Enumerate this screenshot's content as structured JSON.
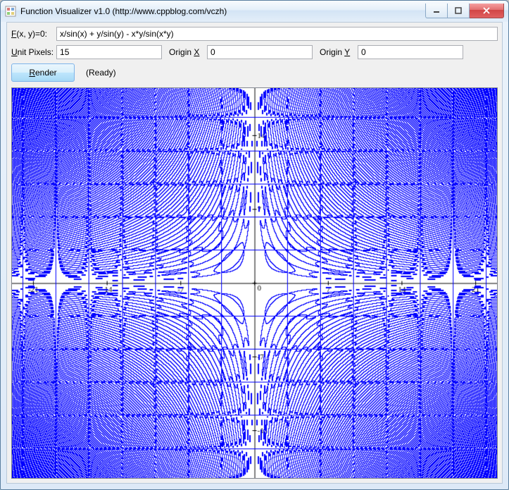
{
  "window": {
    "title": "Function Visualizer v1.0 (http://www.cppblog.com/vczh)"
  },
  "form": {
    "formula_label_prefix": "F",
    "formula_label_rest": "(x, y)=0:",
    "formula_value": "x/sin(x) + y/sin(y) - x*y/sin(x*y)",
    "unit_label_prefix": "U",
    "unit_label_rest": "nit Pixels:",
    "unit_value": "15",
    "origin_x_label_prefix": "Origin ",
    "origin_x_label_key": "X",
    "origin_x_value": "0",
    "origin_y_label_prefix": "Origin ",
    "origin_y_label_key": "Y",
    "origin_y_value": "0",
    "render_label_key": "R",
    "render_label_rest": "ender",
    "status": "(Ready)"
  },
  "chart_data": {
    "type": "implicit-contour",
    "equation": "x/sin(x) + y/sin(y) - x*y/sin(x*y) = 0",
    "unit_pixels": 15,
    "origin": {
      "x": 0,
      "y": 0
    },
    "x_range": [
      -23,
      23
    ],
    "y_range": [
      -18,
      18
    ],
    "x_ticks": [
      -21,
      -14,
      -7,
      0,
      7,
      14,
      21
    ],
    "y_ticks": [
      -14,
      -7,
      0,
      7,
      14
    ],
    "axis_color": "#000000",
    "curve_color": "#0000ff",
    "background": "#ffffff"
  }
}
